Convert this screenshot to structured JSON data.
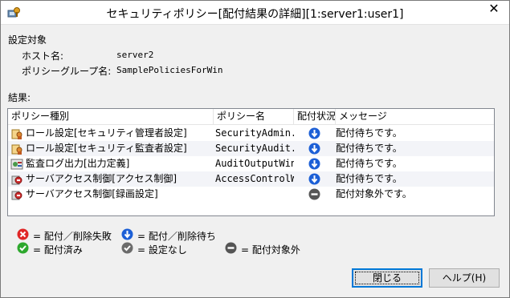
{
  "window": {
    "title": "セキュリティポリシー[配付結果の詳細][1:server1:user1]",
    "close_glyph": "✕"
  },
  "target": {
    "section_label": "設定対象",
    "host_label": "ホスト名:",
    "host_value": "server2",
    "group_label": "ポリシーグループ名:",
    "group_value": "SamplePoliciesForWin"
  },
  "results": {
    "section_label": "結果:",
    "columns": [
      "ポリシー種別",
      "ポリシー名",
      "配付状況",
      "メッセージ"
    ],
    "rows": [
      {
        "type": "ロール設定[セキュリティ管理者設定]",
        "name": "SecurityAdmin...",
        "status": "waiting",
        "message": "配付待ちです。",
        "icon": "role-icon"
      },
      {
        "type": "ロール設定[セキュリティ監査者設定]",
        "name": "SecurityAudit...",
        "status": "waiting",
        "message": "配付待ちです。",
        "icon": "role-icon"
      },
      {
        "type": "監査ログ出力[出力定義]",
        "name": "AuditOutputWin",
        "status": "waiting",
        "message": "配付待ちです。",
        "icon": "audit-icon"
      },
      {
        "type": "サーバアクセス制御[アクセス制御]",
        "name": "AccessControlWin",
        "status": "waiting",
        "message": "配付待ちです。",
        "icon": "access-control-icon"
      },
      {
        "type": "サーバアクセス制御[録画設定]",
        "name": "",
        "status": "excluded",
        "message": "配付対象外です。",
        "icon": "access-control-icon"
      }
    ]
  },
  "legend": {
    "failed": "= 配付／削除失敗",
    "waiting": "= 配付／削除待ち",
    "done": "= 配付済み",
    "none": "= 設定なし",
    "excluded": "= 配付対象外"
  },
  "buttons": {
    "close": "閉じる",
    "help": "ヘルプ(H)"
  },
  "colors": {
    "waiting": "#1c5fd6",
    "failed": "#e02626",
    "done": "#2ea82e",
    "none": "#6b6b6b",
    "excluded": "#555555"
  }
}
